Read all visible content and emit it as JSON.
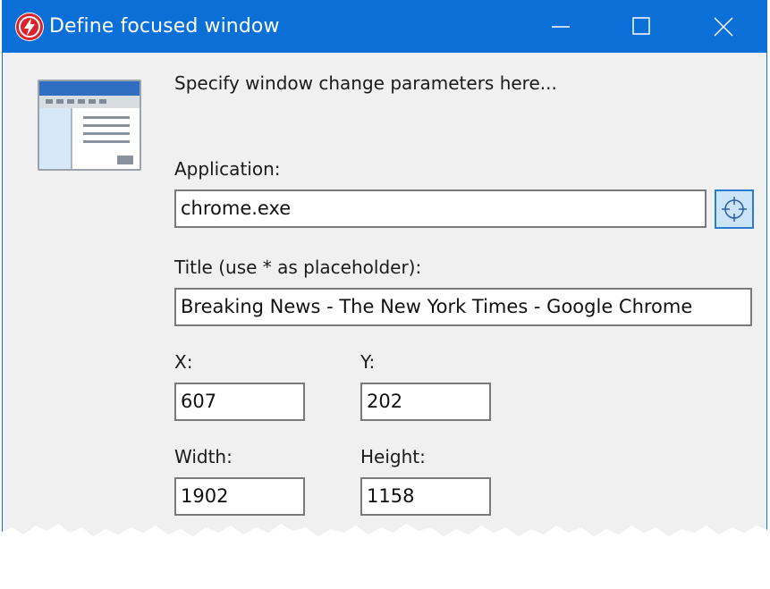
{
  "window": {
    "title": "Define focused window",
    "minimize_icon": "minimize-icon",
    "maximize_icon": "maximize-icon",
    "close_icon": "close-icon",
    "app_icon": "lightning-bolt-icon"
  },
  "header": {
    "description": "Specify window change parameters here...",
    "icon": "window-layout-icon"
  },
  "form": {
    "application": {
      "label": "Application:",
      "value": "chrome.exe",
      "picker_icon": "crosshair-target-icon"
    },
    "title": {
      "label": "Title (use * as placeholder):",
      "value": "Breaking News - The New York Times - Google Chrome"
    },
    "x": {
      "label": "X:",
      "value": "607"
    },
    "y": {
      "label": "Y:",
      "value": "202"
    },
    "width": {
      "label": "Width:",
      "value": "1902"
    },
    "height": {
      "label": "Height:",
      "value": "1158"
    }
  },
  "colors": {
    "titlebar": "#0b6fd8",
    "background": "#f0f0f0",
    "accent": "#2b7bd0"
  }
}
